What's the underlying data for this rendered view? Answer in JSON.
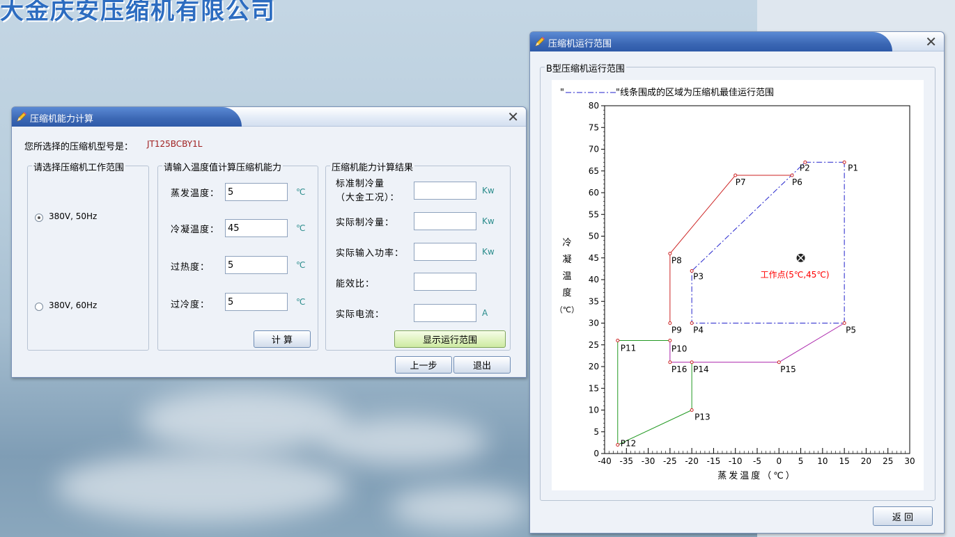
{
  "company": {
    "name": "大金庆安压缩机有限公司"
  },
  "calc_window": {
    "title": "压缩机能力计算",
    "model_label": "您所选择的压缩机型号是：",
    "model_value": "JT125BCBY1L",
    "range_group": {
      "title": "请选择压缩机工作范围",
      "options": [
        {
          "label": "380V, 50Hz",
          "selected": true
        },
        {
          "label": "380V, 60Hz",
          "selected": false
        }
      ]
    },
    "input_group": {
      "title": "请输入温度值计算压缩机能力",
      "fields": [
        {
          "label": "蒸发温度：",
          "value": "5",
          "unit": "℃"
        },
        {
          "label": "冷凝温度：",
          "value": "45",
          "unit": "℃"
        },
        {
          "label": "过热度：",
          "value": "5",
          "unit": "℃"
        },
        {
          "label": "过冷度：",
          "value": "5",
          "unit": "℃"
        }
      ],
      "calc_button": "计 算"
    },
    "result_group": {
      "title": "压缩机能力计算结果",
      "fields": [
        {
          "label": "标准制冷量",
          "label2": "（大金工况）：",
          "value": "",
          "unit": "Kw"
        },
        {
          "label": "实际制冷量：",
          "value": "",
          "unit": "Kw"
        },
        {
          "label": "实际输入功率：",
          "value": "",
          "unit": "Kw"
        },
        {
          "label": "能效比：",
          "value": "",
          "unit": ""
        },
        {
          "label": "实际电流：",
          "value": "",
          "unit": "A"
        }
      ],
      "show_range_button": "显示运行范围"
    },
    "prev_button": "上一步",
    "exit_button": "退出"
  },
  "range_window": {
    "title": "压缩机运行范围",
    "group_title": "B型压缩机运行范围",
    "back_button": "返 回"
  },
  "chart_data": {
    "type": "line",
    "legend_quote_open": "\"",
    "legend_text": "\"线条围成的区域为压缩机最佳运行范围",
    "xlabel": "蒸发温度（℃）",
    "ylabel": "冷凝温度（℃）",
    "xlim": [
      -40,
      30
    ],
    "ylim": [
      0,
      80
    ],
    "xticks": [
      -40,
      -35,
      -30,
      -25,
      -20,
      -15,
      -10,
      -5,
      0,
      5,
      10,
      15,
      20,
      25,
      30
    ],
    "yticks": [
      0,
      5,
      10,
      15,
      20,
      25,
      30,
      35,
      40,
      45,
      50,
      55,
      60,
      65,
      70,
      75,
      80
    ],
    "points": [
      {
        "name": "P1",
        "x": 15,
        "y": 67
      },
      {
        "name": "P2",
        "x": 6,
        "y": 67
      },
      {
        "name": "P3",
        "x": -20,
        "y": 42
      },
      {
        "name": "P4",
        "x": -20,
        "y": 30
      },
      {
        "name": "P5",
        "x": 15,
        "y": 30
      },
      {
        "name": "P6",
        "x": 3,
        "y": 64
      },
      {
        "name": "P7",
        "x": -10,
        "y": 64
      },
      {
        "name": "P8",
        "x": -25,
        "y": 46
      },
      {
        "name": "P9",
        "x": -25,
        "y": 30
      },
      {
        "name": "P10",
        "x": -25,
        "y": 26
      },
      {
        "name": "P11",
        "x": -37,
        "y": 26
      },
      {
        "name": "P12",
        "x": -37,
        "y": 2
      },
      {
        "name": "P13",
        "x": -20,
        "y": 10
      },
      {
        "name": "P14",
        "x": -20,
        "y": 21
      },
      {
        "name": "P15",
        "x": 0,
        "y": 21
      },
      {
        "name": "P16",
        "x": -25,
        "y": 21
      }
    ],
    "series": [
      {
        "style": "dashdot",
        "color": "#2222cc",
        "path": [
          "P1",
          "P2",
          "P3",
          "P4",
          "P5",
          "P1"
        ]
      },
      {
        "style": "solid",
        "color": "#cc2222",
        "path": [
          "P6",
          "P7",
          "P8",
          "P9"
        ]
      },
      {
        "style": "solid",
        "color": "#229922",
        "path": [
          "P10",
          "P11",
          "P12",
          "P13",
          "P14"
        ]
      },
      {
        "style": "solid",
        "color": "#aa22aa",
        "path": [
          "P5",
          "P15",
          "P14",
          "P16",
          "P10"
        ]
      }
    ],
    "working_point": {
      "x": 5,
      "y": 45,
      "label": "工作点(5℃,45℃)",
      "color": "#ff0000"
    }
  }
}
